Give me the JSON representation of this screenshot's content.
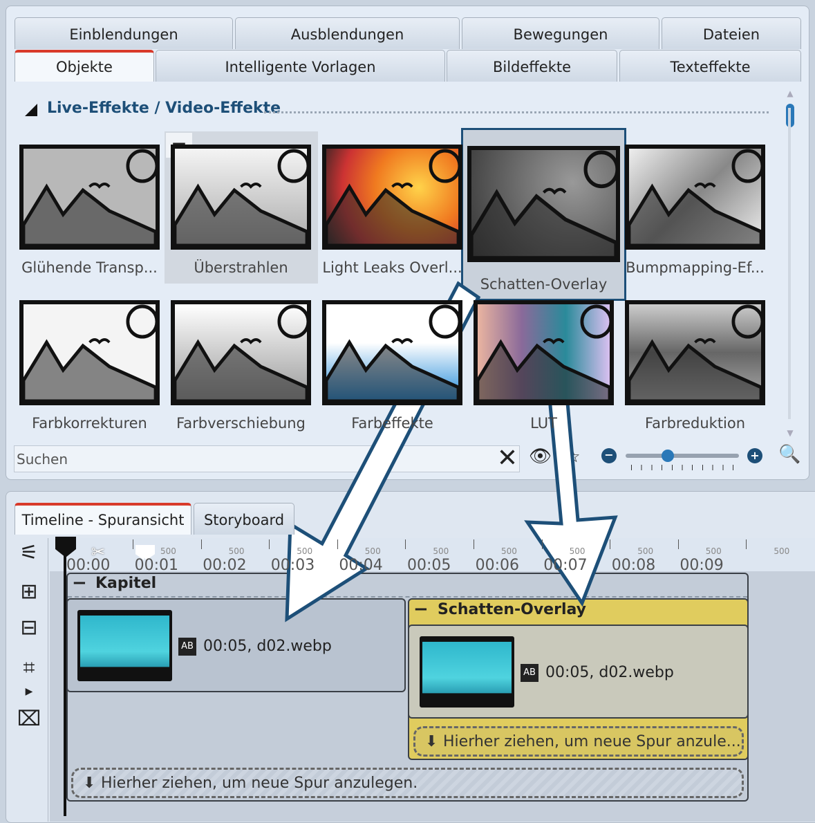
{
  "tabs_row1": [
    "Einblendungen",
    "Ausblendungen",
    "Bewegungen",
    "Dateien"
  ],
  "tabs_row2": [
    "Objekte",
    "Intelligente Vorlagen",
    "Bildeffekte",
    "Texteffekte"
  ],
  "section_title": "Live-Effekte / Video-Effekte",
  "effects": [
    {
      "label": "Glühende Transp..."
    },
    {
      "label": "Überstrahlen"
    },
    {
      "label": "Light Leaks Overl..."
    },
    {
      "label": "Schatten-Overlay"
    },
    {
      "label": "Bumpmapping-Ef..."
    },
    {
      "label": "Farbkorrekturen"
    },
    {
      "label": "Farbverschiebung"
    },
    {
      "label": "Farbeffekte"
    },
    {
      "label": "LUT"
    },
    {
      "label": "Farbreduktion"
    }
  ],
  "hover_remove_label": "−",
  "search": {
    "placeholder": "Suchen"
  },
  "zoom_slider": {
    "value_percent": 37
  },
  "bottom_tabs": [
    "Timeline - Spuransicht",
    "Storyboard"
  ],
  "ruler": {
    "labels": [
      "00:00",
      "00:01",
      "00:02",
      "00:03",
      "00:04",
      "00:05",
      "00:06",
      "00:07",
      "00:08",
      "00:09"
    ],
    "minor": "500"
  },
  "timeline": {
    "chapter": "Kapitel",
    "clip1": {
      "duration": "00:05,",
      "file": "d02.webp"
    },
    "overlay": {
      "title": "Schatten-Overlay",
      "duration": "00:05,",
      "file": "d02.webp",
      "drop": "Hierher ziehen, um neue Spur anzule..."
    },
    "chapter_drop": "Hierher ziehen, um neue Spur anzulegen.",
    "collapse": "−"
  },
  "colors": {
    "accent": "#1d4f78",
    "active_tab": "#d83a2a",
    "overlay_yellow": "#dcc95a"
  }
}
